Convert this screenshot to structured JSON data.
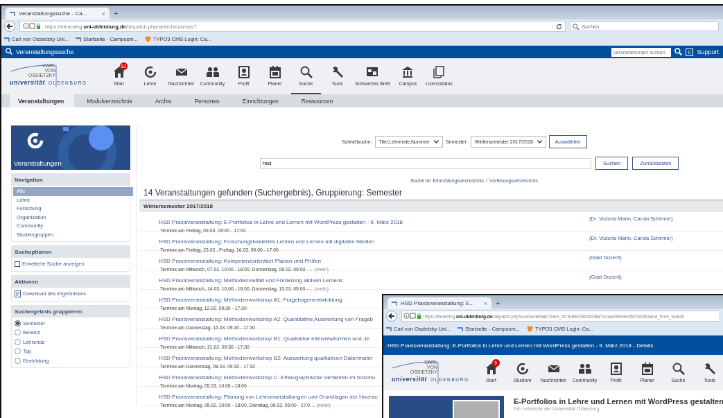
{
  "browser": {
    "tab_title": "Veranstaltungssuche - Ca...",
    "tab_close": "×",
    "new_tab": "+",
    "url": "https://elearning.**uni-oldenburg.de**/dispatch.php/search/courses?",
    "search_placeholder": "Suchen",
    "bookmarks": [
      {
        "label": "Carl von Ossietzky Uni...",
        "kind": "page"
      },
      {
        "label": "Startseite - Campusm...",
        "kind": "page"
      },
      {
        "label": "TYPO3 CMS Login: Ca...",
        "kind": "typo3"
      }
    ]
  },
  "title_bar": {
    "title": "Veranstaltungssuche",
    "search_placeholder": "Veranstaltungen suchen",
    "counter": "0",
    "support": "Support"
  },
  "logo": {
    "lines": [
      "CARL",
      "VON",
      "OSSIETZKY"
    ],
    "word1": "universität",
    "word2": "OLDENBURG"
  },
  "nav": [
    {
      "label": "Start",
      "kind": "home",
      "badge": "10",
      "selected": false
    },
    {
      "label": "Lehre",
      "kind": "target",
      "selected": false
    },
    {
      "label": "Nachrichten",
      "kind": "mail",
      "selected": false
    },
    {
      "label": "Community",
      "kind": "people",
      "selected": false
    },
    {
      "label": "Profil",
      "kind": "profile",
      "selected": false
    },
    {
      "label": "Planer",
      "kind": "calendar",
      "selected": false
    },
    {
      "label": "Suche",
      "kind": "search",
      "selected": true
    },
    {
      "label": "Tools",
      "kind": "wrench",
      "selected": false
    },
    {
      "label": "Schwarzes Brett",
      "kind": "board",
      "selected": false
    },
    {
      "label": "Campus",
      "kind": "building",
      "selected": false
    },
    {
      "label": "Lizenzstatus",
      "kind": "document",
      "selected": false
    }
  ],
  "subnav": [
    {
      "label": "Veranstaltungen",
      "selected": true
    },
    {
      "label": "Modulverzeichnis",
      "selected": false
    },
    {
      "label": "Archiv",
      "selected": false
    },
    {
      "label": "Personen",
      "selected": false
    },
    {
      "label": "Einrichtungen",
      "selected": false
    },
    {
      "label": "Ressourcen",
      "selected": false
    }
  ],
  "sidebar": {
    "banner_title": "Veranstaltungen",
    "sections": [
      {
        "kind": "links",
        "title": "Navigation",
        "items": [
          {
            "label": "Alle",
            "selected": true
          },
          {
            "label": "Lehre",
            "selected": false
          },
          {
            "label": "Forschung",
            "selected": false
          },
          {
            "label": "Organisation",
            "selected": false
          },
          {
            "label": "Community",
            "selected": false
          },
          {
            "label": "Studiengruppen",
            "selected": false
          }
        ]
      },
      {
        "kind": "checkbox",
        "title": "Suchoptionen",
        "items": [
          {
            "label": "Erweiterte Suche anzeigen",
            "checked": false
          }
        ]
      },
      {
        "kind": "actions",
        "title": "Aktionen",
        "items": [
          {
            "label": "Download des Ergebnisses"
          }
        ]
      },
      {
        "kind": "radio",
        "title": "Suchergebnis gruppieren:",
        "items": [
          {
            "label": "Semester",
            "selected": true
          },
          {
            "label": "Bereich",
            "selected": false
          },
          {
            "label": "Lehrende",
            "selected": false
          },
          {
            "label": "Typ",
            "selected": false
          },
          {
            "label": "Einrichtung",
            "selected": false
          }
        ]
      }
    ]
  },
  "search": {
    "quick_label": "Schnellsuche:",
    "quick_value": "Titel,Lehrende,Nummer",
    "semester_label": "Semester:",
    "semester_value": "Wintersemester 2017/2018",
    "select_button": "Auswählen",
    "query": "hsd",
    "search_button": "Suchen",
    "reset_button": "Zurücksetzen",
    "hint_prefix": "Suche im",
    "hint_links": [
      "Einrichtungsverzeichnis",
      "Vorlesungsverzeichnis"
    ],
    "hint_separator": "/"
  },
  "results": {
    "heading": "14 Veranstaltungen gefunden (Suchergebnis), Gruppierung: Semester",
    "groups": [
      {
        "title": "Wintersemester 2017/2018",
        "rows": [
          {
            "title": "HSD Praxisveranstaltung: E-Portfolios in Lehre und Lernen mit WordPress gestalten - 9. März 2018",
            "dates": "Termine am Freitag, 09.03. 09:00 - 17:00",
            "lecturers": "(Dr. Victoria Marin, Carola Schirmer)"
          },
          {
            "title": "HSD Praxisveranstaltung: Forschungsbasiertes Lehren und Lernen mit digitalen Medien",
            "dates": "Termine am Freitag, 23.02., Freitag, 16.03. 09:00 - 17:00",
            "lecturers": "(Dr. Victoria Marin, Carola Schirmer)"
          },
          {
            "title": "HSD Praxisveranstaltung: Kompetenzorientiert Planen und Prüfen",
            "dates": "Termine am Mittwoch, 07.02. 10:00 - 18:00, Donnerstag, 08.02. 09:00 - ...",
            "more": "(mehr)",
            "lecturers": "(Gast Dozent)"
          },
          {
            "title": "HSD Praxisveranstaltung: Methodenvielfalt und Förderung aktiven Lernens",
            "dates": "Termine am Mittwoch, 14.03. 10:00 - 18:00, Donnerstag, 15.03. 09:00 - ...",
            "more": "(mehr)",
            "lecturers": "(Gast Dozent)"
          },
          {
            "title": "HSD Praxisveranstaltung: Methodenworkshop A1: Fragebogenentwicklung",
            "dates": "Termine am Montag, 12.02. 09:30 - 17:30"
          },
          {
            "title": "HSD Praxisveranstaltung: Methodenworkshop A2: Quantitative Auswertung von Frageb",
            "dates": "Termine am Donnerstag, 15.03. 09:30 - 17:30"
          },
          {
            "title": "HSD Praxisveranstaltung: Methodenworkshop B1: Qualitative Interviewformen und -te",
            "dates": "Termine am Mittwoch, 21.02. 09:30 - 17:30"
          },
          {
            "title": "HSD Praxisveranstaltung: Methodenworkshop B2: Auswertung qualitativen Datenmater",
            "dates": "Termine am Donnerstag, 08.03. 09:30 - 17:30"
          },
          {
            "title": "HSD Praxisveranstaltung: Methodenworkshop C: Ethnographische Verfahren im forschu",
            "dates": "Termine am Montag, 05.03. 10:00 - 18:00"
          },
          {
            "title": "HSD Praxisveranstaltung: Planung von Lehrveranstaltungen und Grundlagen der Hochsc",
            "dates": "Termine am Montag, 05.02. 10:00 - 18:00, Dienstag, 06.02. 09:00 - 17:0 ...",
            "more": "(mehr)"
          }
        ]
      }
    ]
  },
  "detail_window": {
    "tab_title": "HSD Praxisveranstaltung: E...",
    "tab_close": "×",
    "new_tab": "+",
    "url": "https://elearning.**uni-oldenburg.de**/dispatch.php/course/details/?sem_id=6de8d383bcb8af7ccaae5e84e4567b03&send_from_search",
    "bookmarks": [
      {
        "label": "Carl von Ossietzky Uni...",
        "kind": "page"
      },
      {
        "label": "Startseite - Campusm...",
        "kind": "page"
      },
      {
        "label": "TYPO3 CMS Login: Ca...",
        "kind": "typo3"
      }
    ],
    "title": "HSD Praxisveranstaltung: E-Portfolios in Lehre und Lernen mit WordPress gestalten - 9. März 2018 - Details",
    "logo": {
      "lines": [
        "CARL",
        "VON",
        "OSSIETZKY"
      ],
      "word1": "universität",
      "word2": "OLDENBURG"
    },
    "nav": [
      {
        "label": "Start",
        "kind": "home",
        "badge": "9",
        "selected": false
      },
      {
        "label": "Studium",
        "kind": "target",
        "selected": false
      },
      {
        "label": "Nachrichten",
        "kind": "mail",
        "selected": false
      },
      {
        "label": "Community",
        "kind": "people",
        "selected": false
      },
      {
        "label": "Profil",
        "kind": "profile",
        "selected": false
      },
      {
        "label": "Planer",
        "kind": "calendar",
        "selected": false
      },
      {
        "label": "Suche",
        "kind": "search",
        "selected": false
      },
      {
        "label": "Tools",
        "kind": "wrench",
        "selected": false
      }
    ],
    "heading": "E-Portfolios in Lehre und Lernen mit WordPress gestalten",
    "subtitle": "Für Lehrende der Universität Oldenburg"
  }
}
